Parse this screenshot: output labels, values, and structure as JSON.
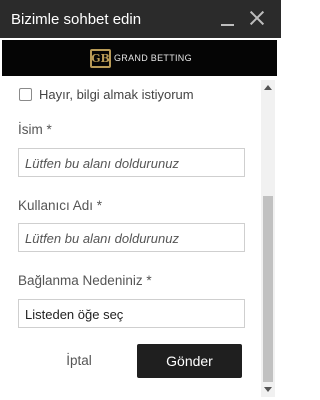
{
  "header": {
    "title": "Bizimle sohbet edin",
    "minimize_icon": "minimize-icon",
    "close_icon": "close-icon",
    "bg_color": "#2b2b2b"
  },
  "banner": {
    "logo_mark": "GB",
    "logo_text": "GRAND BETTING",
    "logo_color": "#b89a56"
  },
  "form": {
    "opt_out_label": "Hayır, bilgi almak istiyorum",
    "opt_out_checked": false,
    "name_label": "İsim *",
    "name_placeholder": "Lütfen bu alanı doldurunuz",
    "username_label": "Kullanıcı Adı *",
    "username_placeholder": "Lütfen bu alanı doldurunuz",
    "reason_label": "Bağlanma Nedeniniz *",
    "reason_value": "Listeden öğe seç",
    "cancel_label": "İptal",
    "send_label": "Gönder"
  }
}
